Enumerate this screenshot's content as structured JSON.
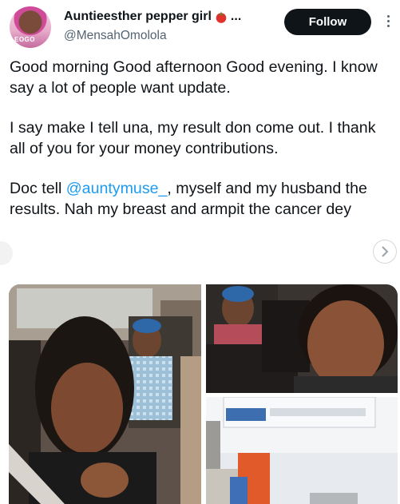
{
  "author": {
    "display_name": "Auntieesther pepper girl",
    "name_ellipsis": "...",
    "handle": "@MensahOmolola",
    "avatar_text": "EOGO",
    "badge_icon": "tomato-icon"
  },
  "follow_button": {
    "label": "Follow"
  },
  "tweet": {
    "paragraph_1": "Good morning Good afternoon Good evening. I know say a lot of people want update.",
    "paragraph_2": "I say make I tell una, my result don come out. I thank all of you for your money contributions.",
    "paragraph_3_prefix": "Doc tell ",
    "mention": "@auntymuse_",
    "paragraph_3_suffix": ", myself and my husband the results. Nah my breast and armpit the cancer dey"
  },
  "media": [
    {
      "description": "woman selfie in car with older woman in background",
      "icon": "photo"
    },
    {
      "description": "selfie of women in car",
      "icon": "photo"
    },
    {
      "description": "hospital room with air conditioner",
      "icon": "photo"
    }
  ],
  "colors": {
    "link": "#1d9bf0",
    "text": "#0f1419",
    "secondary": "#536471",
    "button_bg": "#0f1419"
  }
}
